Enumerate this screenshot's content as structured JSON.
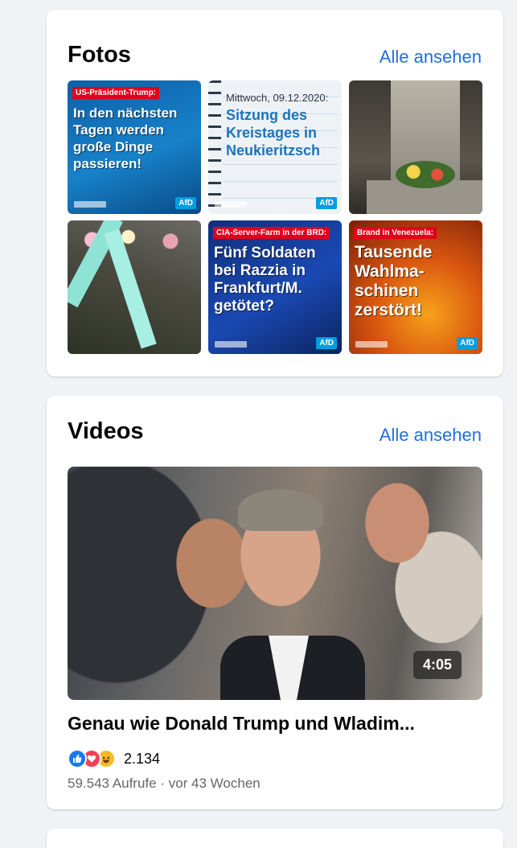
{
  "photos": {
    "title": "Fotos",
    "see_all": "Alle ansehen",
    "tiles": [
      {
        "tag": "US-Präsident-Trump:",
        "headline": "In den nächsten Tagen werden große Dinge passieren!",
        "badge": "AfD"
      },
      {
        "date": "Mittwoch, 09.12.2020:",
        "headline": "Sitzung des Kreistages in Neukieritzsch",
        "badge": "AfD"
      },
      {
        "headline": ""
      },
      {
        "headline": ""
      },
      {
        "tag": "CIA-Server-Farm in der BRD:",
        "headline": "Fünf Soldaten bei Razzia in Frankfurt/M. getötet?",
        "badge": "AfD"
      },
      {
        "tag": "Brand in Venezuela:",
        "headline": "Tausende Wahlma-schinen zerstört!",
        "badge": "AfD"
      }
    ]
  },
  "videos": {
    "title": "Videos",
    "see_all": "Alle ansehen",
    "items": [
      {
        "duration": "4:05",
        "title": "Genau wie Donald Trump und Wladim...",
        "reaction_count": "2.134",
        "meta": "59.543 Aufrufe · vor 43 Wochen"
      }
    ]
  },
  "icons": {
    "like": "like-icon",
    "love": "love-icon",
    "haha": "haha-icon"
  },
  "colors": {
    "link": "#216fdb",
    "background": "#f0f2f5",
    "like": "#1877f2",
    "love": "#f33e58",
    "haha": "#f7b928"
  }
}
